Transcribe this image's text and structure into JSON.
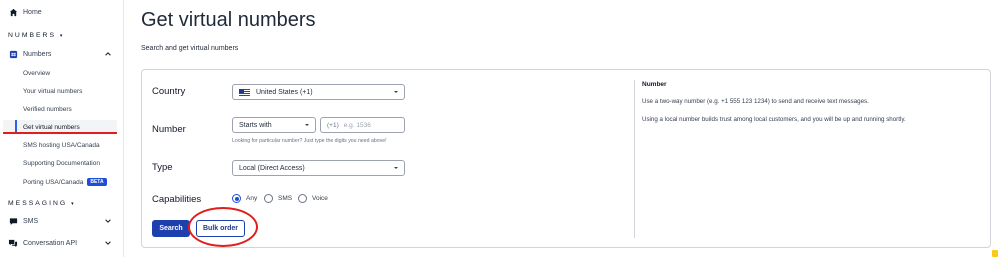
{
  "sidebar": {
    "home_label": "Home",
    "numbers_section": "NUMBERS",
    "numbers_label": "Numbers",
    "sub_items": [
      {
        "label": "Overview"
      },
      {
        "label": "Your virtual numbers"
      },
      {
        "label": "Verified numbers"
      },
      {
        "label": "Get virtual numbers"
      },
      {
        "label": "SMS hosting USA/Canada"
      },
      {
        "label": "Supporting Documentation"
      },
      {
        "label": "Porting USA/Canada"
      }
    ],
    "beta_badge": "BETA",
    "messaging_section": "MESSAGING",
    "sms_label": "SMS",
    "conversation_label": "Conversation API"
  },
  "page": {
    "title": "Get virtual numbers",
    "subtitle": "Search and get virtual numbers"
  },
  "form": {
    "country_label": "Country",
    "country_value": "United States (+1)",
    "number_label": "Number",
    "match_value": "Starts with",
    "number_prefix": "(+1)",
    "number_placeholder": "e.g. 1536",
    "number_hint": "Looking for particular number? Just type the digits you need above!",
    "type_label": "Type",
    "type_value": "Local (Direct Access)",
    "capabilities_label": "Capabilities",
    "capability_options": [
      {
        "label": "Any",
        "selected": true
      },
      {
        "label": "SMS",
        "selected": false
      },
      {
        "label": "Voice",
        "selected": false
      }
    ],
    "search_button": "Search",
    "bulk_order_button": "Bulk order"
  },
  "info_panel": {
    "title": "Number",
    "line1": "Use a two-way number (e.g. +1 555 123 1234) to send and receive text messages.",
    "line2": "Using a local number builds trust among local customers, and you will be up and running shortly."
  },
  "colors": {
    "primary": "#1e40af",
    "annotation": "#e11d1d",
    "active_indicator": "#2563eb"
  }
}
